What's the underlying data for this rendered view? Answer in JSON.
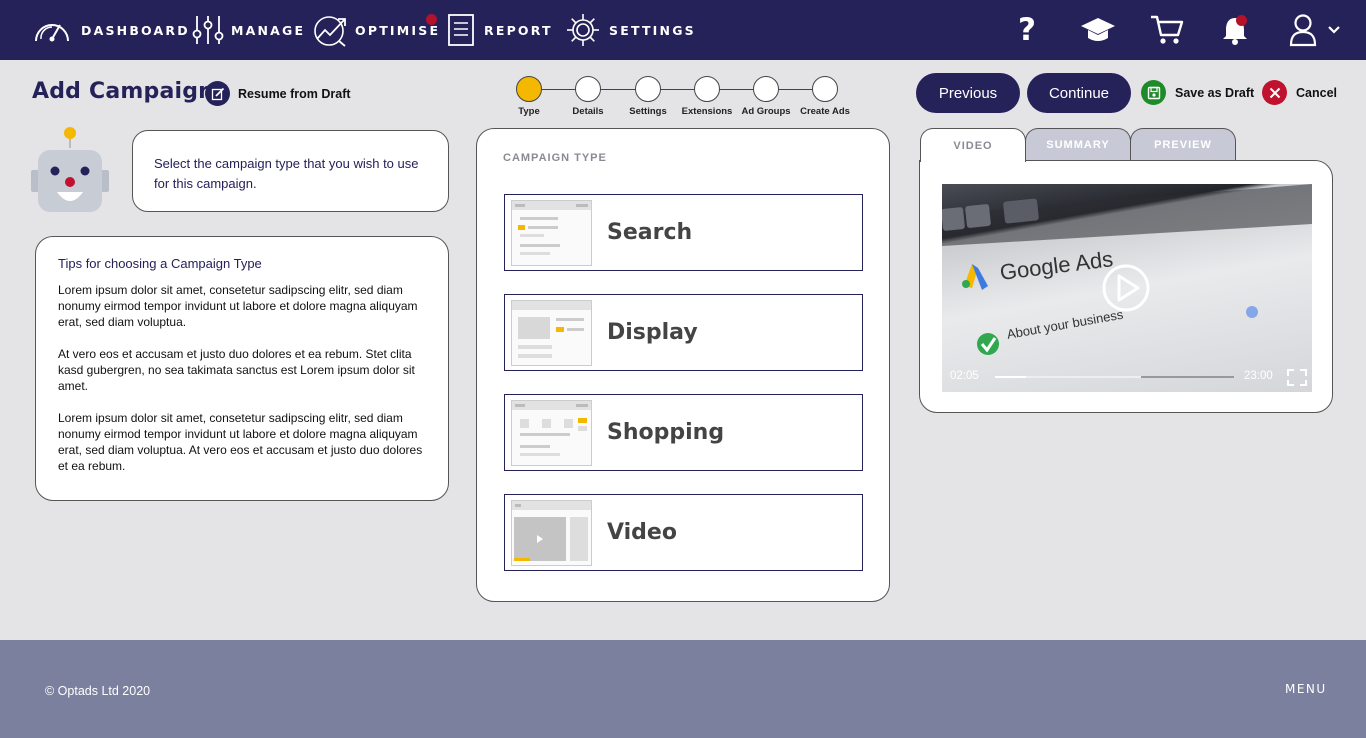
{
  "nav": {
    "items": [
      {
        "label": "DASHBOARD",
        "icon": "gauge-icon"
      },
      {
        "label": "MANAGE",
        "icon": "sliders-icon"
      },
      {
        "label": "OPTIMISE",
        "icon": "trend-chart-icon"
      },
      {
        "label": "REPORT",
        "icon": "document-icon"
      },
      {
        "label": "SETTINGS",
        "icon": "gear-icon"
      }
    ],
    "right_icons": [
      "help-icon",
      "graduation-cap-icon",
      "cart-icon",
      "bell-icon",
      "user-icon",
      "chevron-down-icon"
    ],
    "background": "#252159",
    "notification_color": "#b3122a"
  },
  "header": {
    "title": "Add Campaign",
    "resume_label": "Resume from  Draft",
    "previous_label": "Previous",
    "continue_label": "Continue",
    "save_label": "Save as  Draft",
    "cancel_label": "Cancel"
  },
  "stepper": {
    "steps": [
      "Type",
      "Details",
      "Settings",
      "Extensions",
      "Ad Groups",
      "Create Ads"
    ],
    "active_index": 0,
    "active_color": "#f5b800"
  },
  "assistant": {
    "message": "Select the campaign type that you wish to use for this campaign."
  },
  "tips": {
    "title": "Tips for choosing  a Campaign Type",
    "paragraphs": [
      "Lorem ipsum dolor sit amet, consetetur sadipscing elitr, sed diam nonumy eirmod tempor invidunt ut labore et dolore magna aliquyam erat, sed diam voluptua.",
      "At vero eos et accusam et justo duo dolores et ea rebum. Stet clita kasd gubergren, no sea takimata sanctus est Lorem ipsum dolor sit amet.",
      "Lorem ipsum dolor sit amet, consetetur sadipscing elitr, sed diam nonumy eirmod tempor invidunt ut labore et dolore magna aliquyam erat, sed diam voluptua. At vero eos et accusam et justo duo dolores et ea rebum."
    ]
  },
  "campaign_type": {
    "heading": "CAMPAIGN TYPE",
    "options": [
      "Search",
      "Display",
      "Shopping",
      "Video"
    ]
  },
  "right_panel": {
    "tabs": [
      "VIDEO",
      "SUMMARY",
      "PREVIEW"
    ],
    "active_tab": 0,
    "video": {
      "brand_text": "Google Ads",
      "caption": "About your business",
      "current_time": "02:05",
      "duration": "23:00",
      "progress_fraction": 0.61,
      "buffered_fraction": 0.13
    }
  },
  "footer": {
    "copyright": "© Optads Ltd 2020",
    "menu_label": "MENU",
    "background": "#7a809e"
  }
}
